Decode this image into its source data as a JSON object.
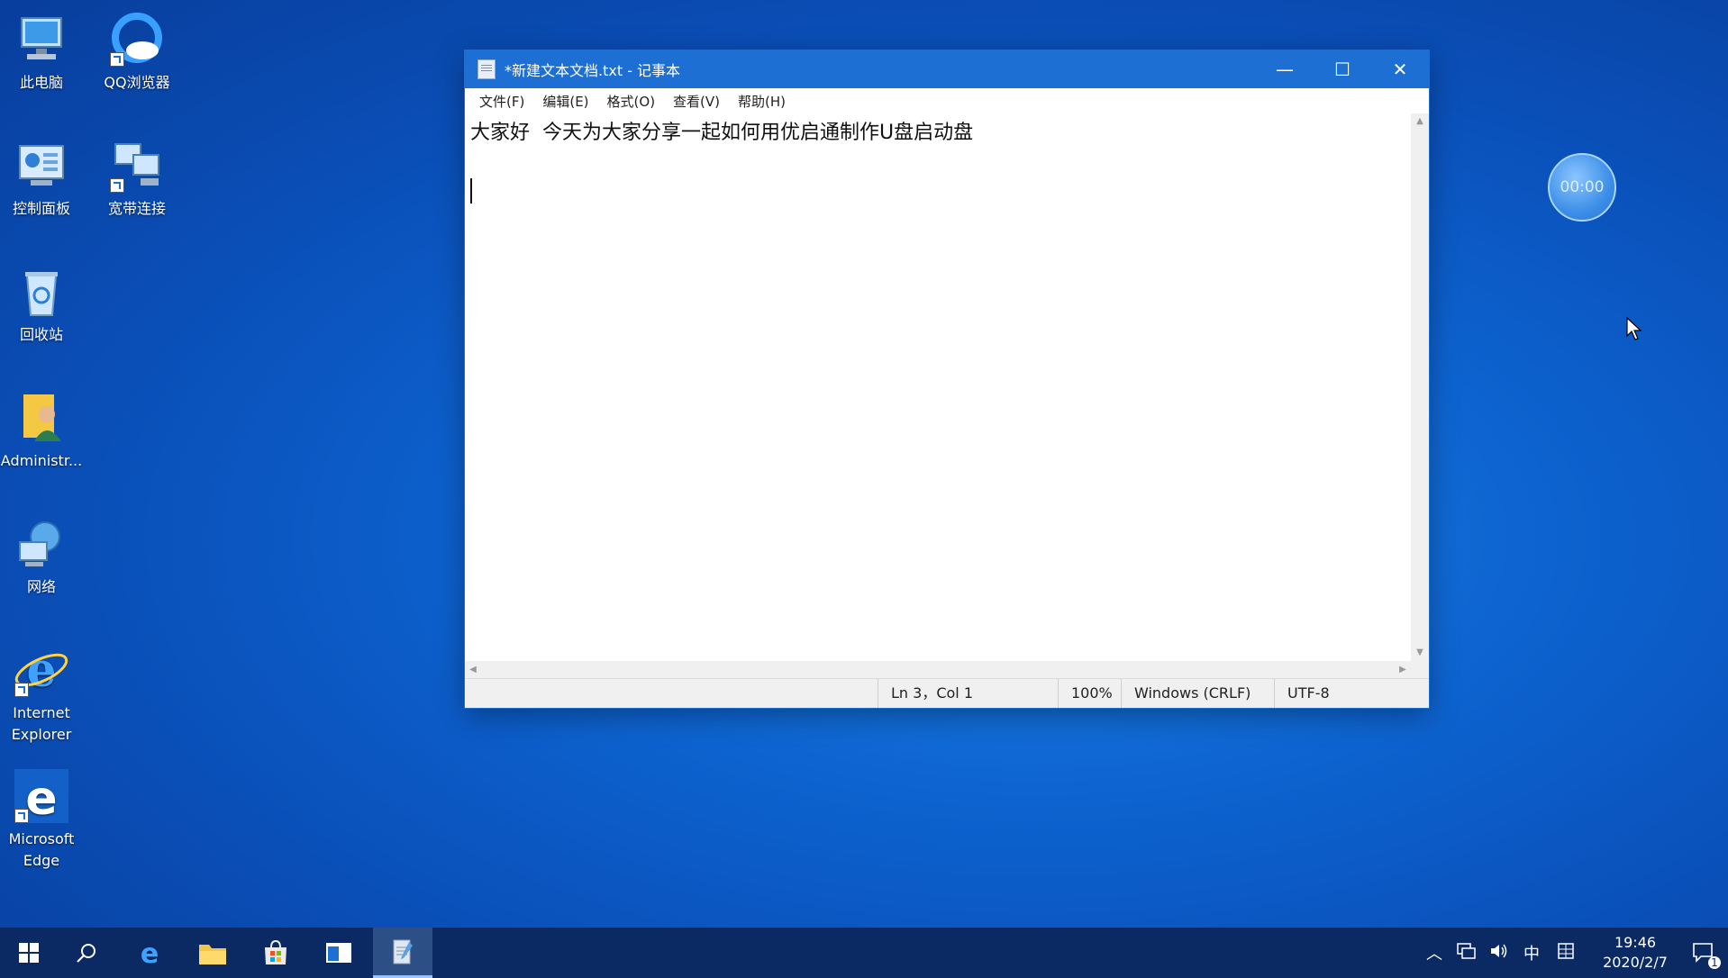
{
  "desktop": {
    "icons": [
      {
        "label": "此电脑"
      },
      {
        "label": "QQ浏览器"
      },
      {
        "label": "控制面板"
      },
      {
        "label": "宽带连接"
      },
      {
        "label": "回收站"
      },
      {
        "label": "Administr..."
      },
      {
        "label": "网络"
      },
      {
        "label": "Internet Explorer"
      },
      {
        "label": "Microsoft Edge"
      }
    ],
    "timer": "00:00"
  },
  "window": {
    "title": "*新建文本文档.txt - 记事本",
    "buttons": {
      "minimize": "—",
      "maximize": "☐",
      "close": "✕"
    },
    "menu": [
      "文件(F)",
      "编辑(E)",
      "格式(O)",
      "查看(V)",
      "帮助(H)"
    ],
    "content": {
      "line1": "大家好  今天为大家分享一起如何用优启通制作U盘启动盘"
    },
    "status": {
      "position": "Ln 3，Col 1",
      "zoom": "100%",
      "line_ending": "Windows (CRLF)",
      "encoding": "UTF-8"
    }
  },
  "taskbar": {
    "ime": "中",
    "time": "19:46",
    "date": "2020/2/7",
    "notifications": "1"
  },
  "colors": {
    "titlebar": "#1d6fd4",
    "taskbar": "#0b2a63",
    "desktop": "#0d63d0"
  }
}
